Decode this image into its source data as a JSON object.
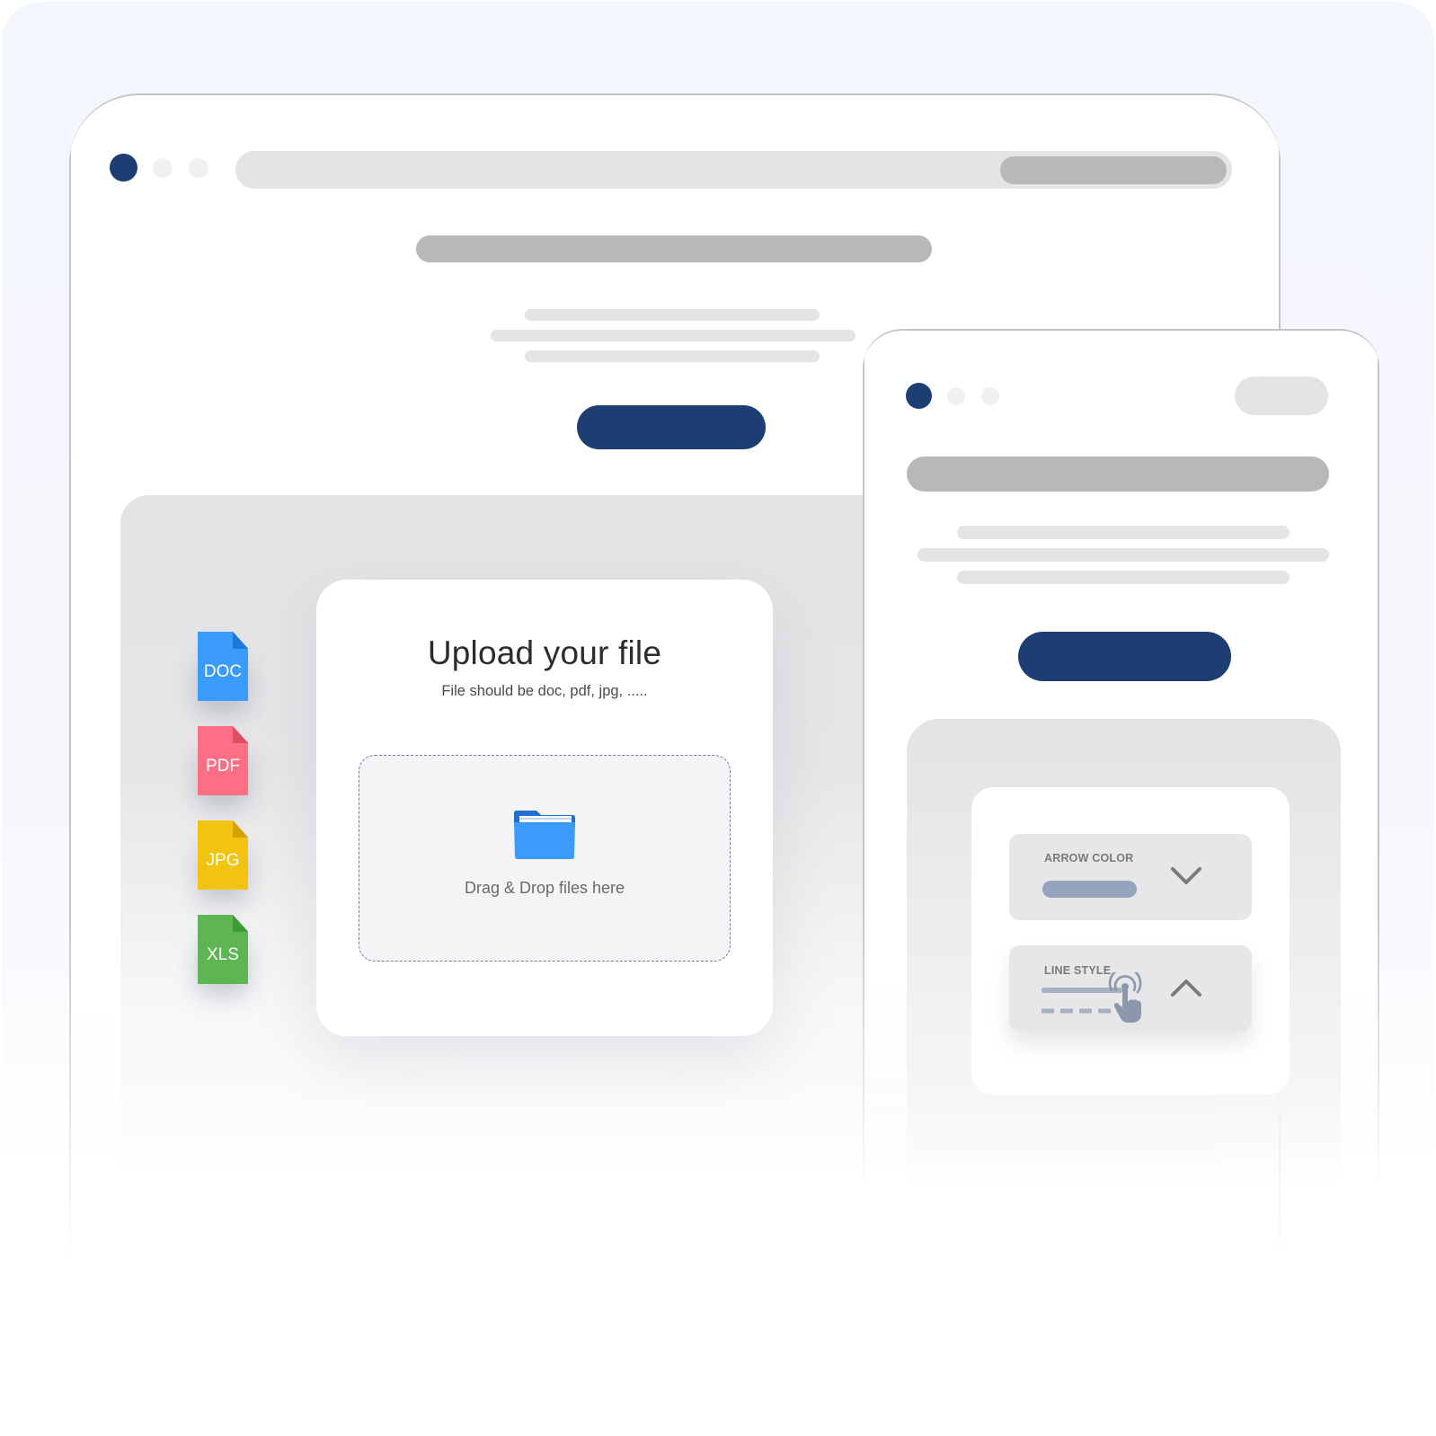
{
  "upload": {
    "title": "Upload your file",
    "subtitle": "File should be doc, pdf, jpg, .....",
    "drop_text": "Drag & Drop files here"
  },
  "file_types": [
    {
      "label": "DOC",
      "color": "#3a9bfb"
    },
    {
      "label": "PDF",
      "color": "#fd6f85"
    },
    {
      "label": "JPG",
      "color": "#f2c40f"
    },
    {
      "label": "XLS",
      "color": "#5db653"
    }
  ],
  "settings": {
    "arrow_color_label": "ARROW COLOR",
    "line_style_label": "LINE STYLE",
    "arrow_color_swatch": "#95a3bc"
  },
  "colors": {
    "primary_button": "#1c3e72",
    "folder": "#3a9bfb"
  }
}
